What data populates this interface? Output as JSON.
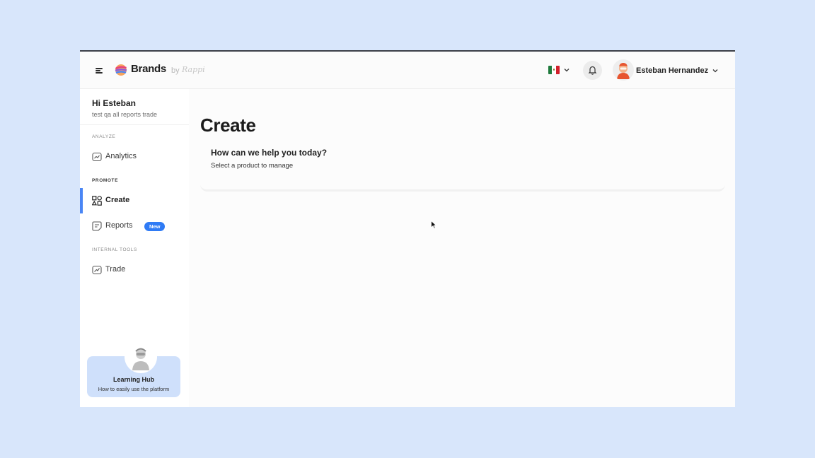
{
  "header": {
    "brand": "Brands",
    "by": "by",
    "sub_brand": "Rappi",
    "user_name": "Esteban Hernandez",
    "flag_colors": [
      "#1e7a3c",
      "#ffffff",
      "#d2202c"
    ]
  },
  "sidebar": {
    "greeting": "Hi Esteban",
    "account": "test qa all reports trade",
    "sections": {
      "analyze": "ANALYZE",
      "promote": "PROMOTE",
      "internal": "INTERNAL TOOLS"
    },
    "items": [
      {
        "label": "Analytics",
        "icon": "analytics-icon"
      },
      {
        "label": "Create",
        "icon": "shapes-icon",
        "active": true
      },
      {
        "label": "Reports",
        "icon": "reports-icon",
        "badge": "New"
      },
      {
        "label": "Trade",
        "icon": "trend-icon"
      }
    ],
    "learning_hub": {
      "title": "Learning Hub",
      "subtitle": "How to easily use the platform"
    }
  },
  "main": {
    "title": "Create",
    "card": {
      "title": "How can we help you today?",
      "subtitle": "Select a product to manage"
    }
  },
  "colors": {
    "accent": "#4a86f5",
    "badge": "#2f7bf5",
    "backdrop": "#d8e6fb"
  }
}
